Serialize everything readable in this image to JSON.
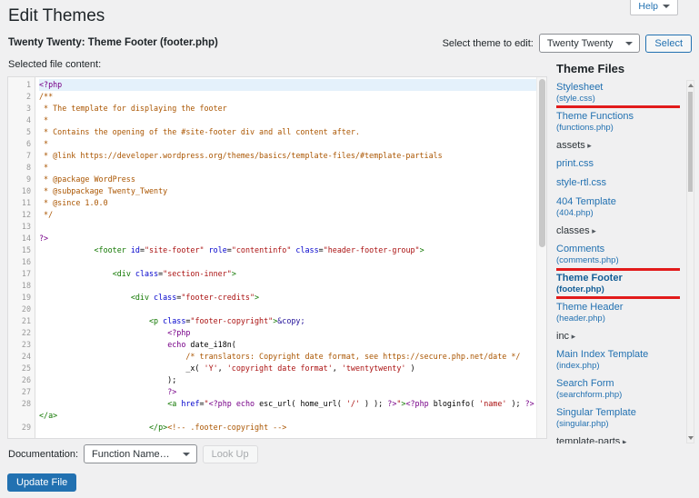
{
  "header": {
    "title": "Edit Themes",
    "help_label": "Help",
    "file_heading": "Twenty Twenty: Theme Footer (footer.php)"
  },
  "theme_select": {
    "label": "Select theme to edit:",
    "value": "Twenty Twenty",
    "button": "Select"
  },
  "editor": {
    "label": "Selected file content:",
    "rows": [
      {
        "n": "1",
        "active": true,
        "tokens": [
          [
            "m",
            "<?php"
          ]
        ]
      },
      {
        "n": "2",
        "tokens": [
          [
            "c",
            "/**"
          ]
        ]
      },
      {
        "n": "3",
        "tokens": [
          [
            "c",
            " * The template for displaying the footer"
          ]
        ]
      },
      {
        "n": "4",
        "tokens": [
          [
            "c",
            " *"
          ]
        ]
      },
      {
        "n": "5",
        "tokens": [
          [
            "c",
            " * Contains the opening of the #site-footer div and all content after."
          ]
        ]
      },
      {
        "n": "6",
        "tokens": [
          [
            "c",
            " *"
          ]
        ]
      },
      {
        "n": "7",
        "tokens": [
          [
            "c",
            " * @link https://developer.wordpress.org/themes/basics/template-files/#template-partials"
          ]
        ]
      },
      {
        "n": "8",
        "tokens": [
          [
            "c",
            " *"
          ]
        ]
      },
      {
        "n": "9",
        "tokens": [
          [
            "c",
            " * @package WordPress"
          ]
        ]
      },
      {
        "n": "10",
        "tokens": [
          [
            "c",
            " * @subpackage Twenty_Twenty"
          ]
        ]
      },
      {
        "n": "11",
        "tokens": [
          [
            "c",
            " * @since 1.0.0"
          ]
        ]
      },
      {
        "n": "12",
        "tokens": [
          [
            "c",
            " */"
          ]
        ]
      },
      {
        "n": "13",
        "tokens": []
      },
      {
        "n": "14",
        "tokens": [
          [
            "m",
            "?>"
          ]
        ]
      },
      {
        "n": "15",
        "tokens": [
          [
            "p",
            "            "
          ],
          [
            "t",
            "<footer"
          ],
          [
            "a",
            " id"
          ],
          [
            "p",
            "="
          ],
          [
            "s",
            "\"site-footer\""
          ],
          [
            "a",
            " role"
          ],
          [
            "p",
            "="
          ],
          [
            "s",
            "\"contentinfo\""
          ],
          [
            "a",
            " class"
          ],
          [
            "p",
            "="
          ],
          [
            "s",
            "\"header-footer-group\""
          ],
          [
            "t",
            ">"
          ]
        ]
      },
      {
        "n": "16",
        "tokens": []
      },
      {
        "n": "17",
        "tokens": [
          [
            "p",
            "                "
          ],
          [
            "t",
            "<div"
          ],
          [
            "a",
            " class"
          ],
          [
            "p",
            "="
          ],
          [
            "s",
            "\"section-inner\""
          ],
          [
            "t",
            ">"
          ]
        ]
      },
      {
        "n": "18",
        "tokens": []
      },
      {
        "n": "19",
        "tokens": [
          [
            "p",
            "                    "
          ],
          [
            "t",
            "<div"
          ],
          [
            "a",
            " class"
          ],
          [
            "p",
            "="
          ],
          [
            "s",
            "\"footer-credits\""
          ],
          [
            "t",
            ">"
          ]
        ]
      },
      {
        "n": "20",
        "tokens": []
      },
      {
        "n": "21",
        "tokens": [
          [
            "p",
            "                        "
          ],
          [
            "t",
            "<p"
          ],
          [
            "a",
            " class"
          ],
          [
            "p",
            "="
          ],
          [
            "s",
            "\"footer-copyright\""
          ],
          [
            "t",
            ">"
          ],
          [
            "at",
            "&copy;"
          ]
        ]
      },
      {
        "n": "22",
        "tokens": [
          [
            "p",
            "                            "
          ],
          [
            "m",
            "<?php"
          ]
        ]
      },
      {
        "n": "23",
        "tokens": [
          [
            "p",
            "                            "
          ],
          [
            "k",
            "echo"
          ],
          [
            "p",
            " date_i18n("
          ]
        ]
      },
      {
        "n": "24",
        "tokens": [
          [
            "p",
            "                                "
          ],
          [
            "c",
            "/* translators: Copyright date format, see https://secure.php.net/date */"
          ]
        ]
      },
      {
        "n": "25",
        "tokens": [
          [
            "p",
            "                                _x( "
          ],
          [
            "s",
            "'Y'"
          ],
          [
            "p",
            ", "
          ],
          [
            "s",
            "'copyright date format'"
          ],
          [
            "p",
            ", "
          ],
          [
            "s",
            "'twentytwenty'"
          ],
          [
            "p",
            " )"
          ]
        ]
      },
      {
        "n": "26",
        "tokens": [
          [
            "p",
            "                            );"
          ]
        ]
      },
      {
        "n": "27",
        "tokens": [
          [
            "p",
            "                            "
          ],
          [
            "m",
            "?>"
          ]
        ]
      },
      {
        "n": "28",
        "tokens": [
          [
            "p",
            "                            "
          ],
          [
            "t",
            "<a"
          ],
          [
            "a",
            " href"
          ],
          [
            "p",
            "="
          ],
          [
            "s",
            "\""
          ],
          [
            "m",
            "<?php"
          ],
          [
            "k",
            " echo"
          ],
          [
            "p",
            " esc_url( home_url( "
          ],
          [
            "s",
            "'/'"
          ],
          [
            "p",
            " ) ); "
          ],
          [
            "m",
            "?>"
          ],
          [
            "s",
            "\""
          ],
          [
            "t",
            ">"
          ],
          [
            "m",
            "<?php"
          ],
          [
            "p",
            " bloginfo( "
          ],
          [
            "s",
            "'name'"
          ],
          [
            "p",
            " ); "
          ],
          [
            "m",
            "?>"
          ]
        ]
      },
      {
        "n": "",
        "tokens": [
          [
            "t",
            "</a>"
          ]
        ]
      },
      {
        "n": "29",
        "tokens": [
          [
            "p",
            "                        "
          ],
          [
            "t",
            "</p>"
          ],
          [
            "c",
            "<!-- .footer-copyright -->"
          ]
        ]
      }
    ]
  },
  "sidebar": {
    "title": "Theme Files",
    "items": [
      {
        "kind": "file",
        "label": "Stylesheet",
        "filename": "(style.css)",
        "boxed": true
      },
      {
        "kind": "file",
        "label": "Theme Functions",
        "filename": "(functions.php)"
      },
      {
        "kind": "folder",
        "label": "assets"
      },
      {
        "kind": "file",
        "label": "print.css"
      },
      {
        "kind": "file",
        "label": "style-rtl.css"
      },
      {
        "kind": "file",
        "label": "404 Template",
        "filename": "(404.php)"
      },
      {
        "kind": "folder",
        "label": "classes"
      },
      {
        "kind": "file",
        "label": "Comments",
        "filename": "(comments.php)"
      },
      {
        "kind": "file",
        "label": "Theme Footer",
        "filename": "(footer.php)",
        "active": true,
        "boxed": true
      },
      {
        "kind": "file",
        "label": "Theme Header",
        "filename": "(header.php)"
      },
      {
        "kind": "folder",
        "label": "inc"
      },
      {
        "kind": "file",
        "label": "Main Index Template",
        "filename": "(index.php)"
      },
      {
        "kind": "file",
        "label": "Search Form",
        "filename": "(searchform.php)"
      },
      {
        "kind": "file",
        "label": "Singular Template",
        "filename": "(singular.php)"
      },
      {
        "kind": "folder",
        "label": "template-parts"
      }
    ]
  },
  "documentation": {
    "label": "Documentation:",
    "select_value": "Function Name…",
    "lookup": "Look Up"
  },
  "update": {
    "label": "Update File"
  },
  "icons": {
    "caret_down": "▼",
    "folder_arrow": "▸"
  },
  "colors": {
    "accent": "#2271b1",
    "link": "#2271b1",
    "annotation": "#e21b1b"
  }
}
